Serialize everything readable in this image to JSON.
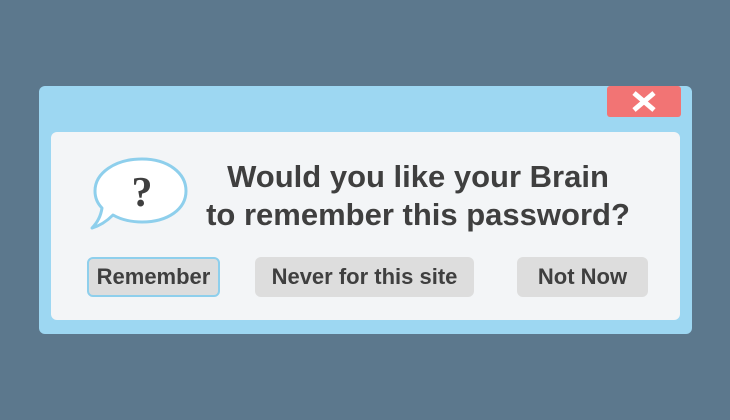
{
  "dialog": {
    "message_line1": "Would you like your Brain",
    "message_line2": "to remember this password?",
    "icon": "question-speech-bubble-icon",
    "close_icon": "close-icon",
    "buttons": {
      "remember": "Remember",
      "never": "Never for this site",
      "not_now": "Not Now"
    }
  },
  "colors": {
    "background": "#5c788d",
    "dialog_frame": "#9dd7f2",
    "close_button": "#f27474",
    "panel": "#f3f5f7",
    "button": "#dddddd",
    "focus_ring": "#8ecfec",
    "text": "#3f3f3f"
  }
}
